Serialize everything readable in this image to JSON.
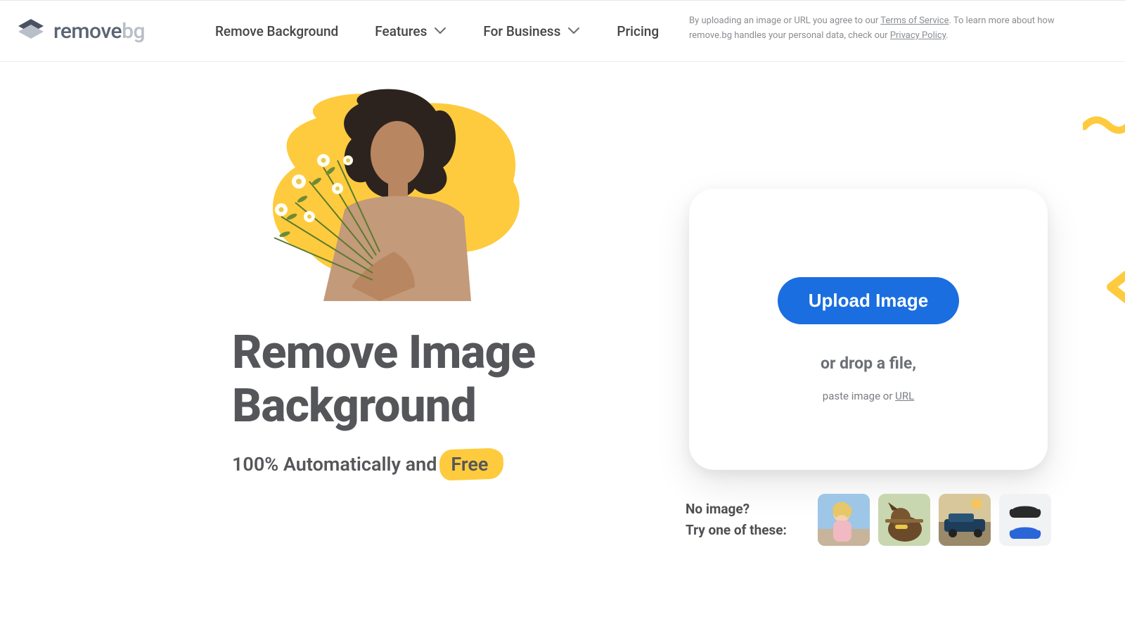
{
  "brand": {
    "name_part_a": "remove",
    "name_part_b": "bg"
  },
  "nav": {
    "remove_bg": "Remove Background",
    "features": "Features",
    "for_business": "For Business",
    "pricing": "Pricing"
  },
  "hero": {
    "headline_line1": "Remove Image",
    "headline_line2": "Background",
    "sub_prefix": "100% Automatically and",
    "sub_highlight": "Free"
  },
  "upload": {
    "button": "Upload Image",
    "drop_text": "or drop a file,",
    "paste_prefix": "paste image or ",
    "paste_link": "URL"
  },
  "samples": {
    "line1": "No image?",
    "line2": "Try one of these:",
    "thumbs": [
      {
        "name": "sample-person"
      },
      {
        "name": "sample-dog"
      },
      {
        "name": "sample-car"
      },
      {
        "name": "sample-controllers"
      }
    ]
  },
  "legal": {
    "p1a": "By uploading an image or URL you agree to our ",
    "tos": "Terms of Service",
    "p1b": ". To learn more about how",
    "p2a": "remove.bg handles your personal data, check our ",
    "privacy": "Privacy Policy",
    "p2b": "."
  },
  "colors": {
    "accent_yellow": "#fecb3e",
    "primary_blue": "#1a6ee0"
  }
}
